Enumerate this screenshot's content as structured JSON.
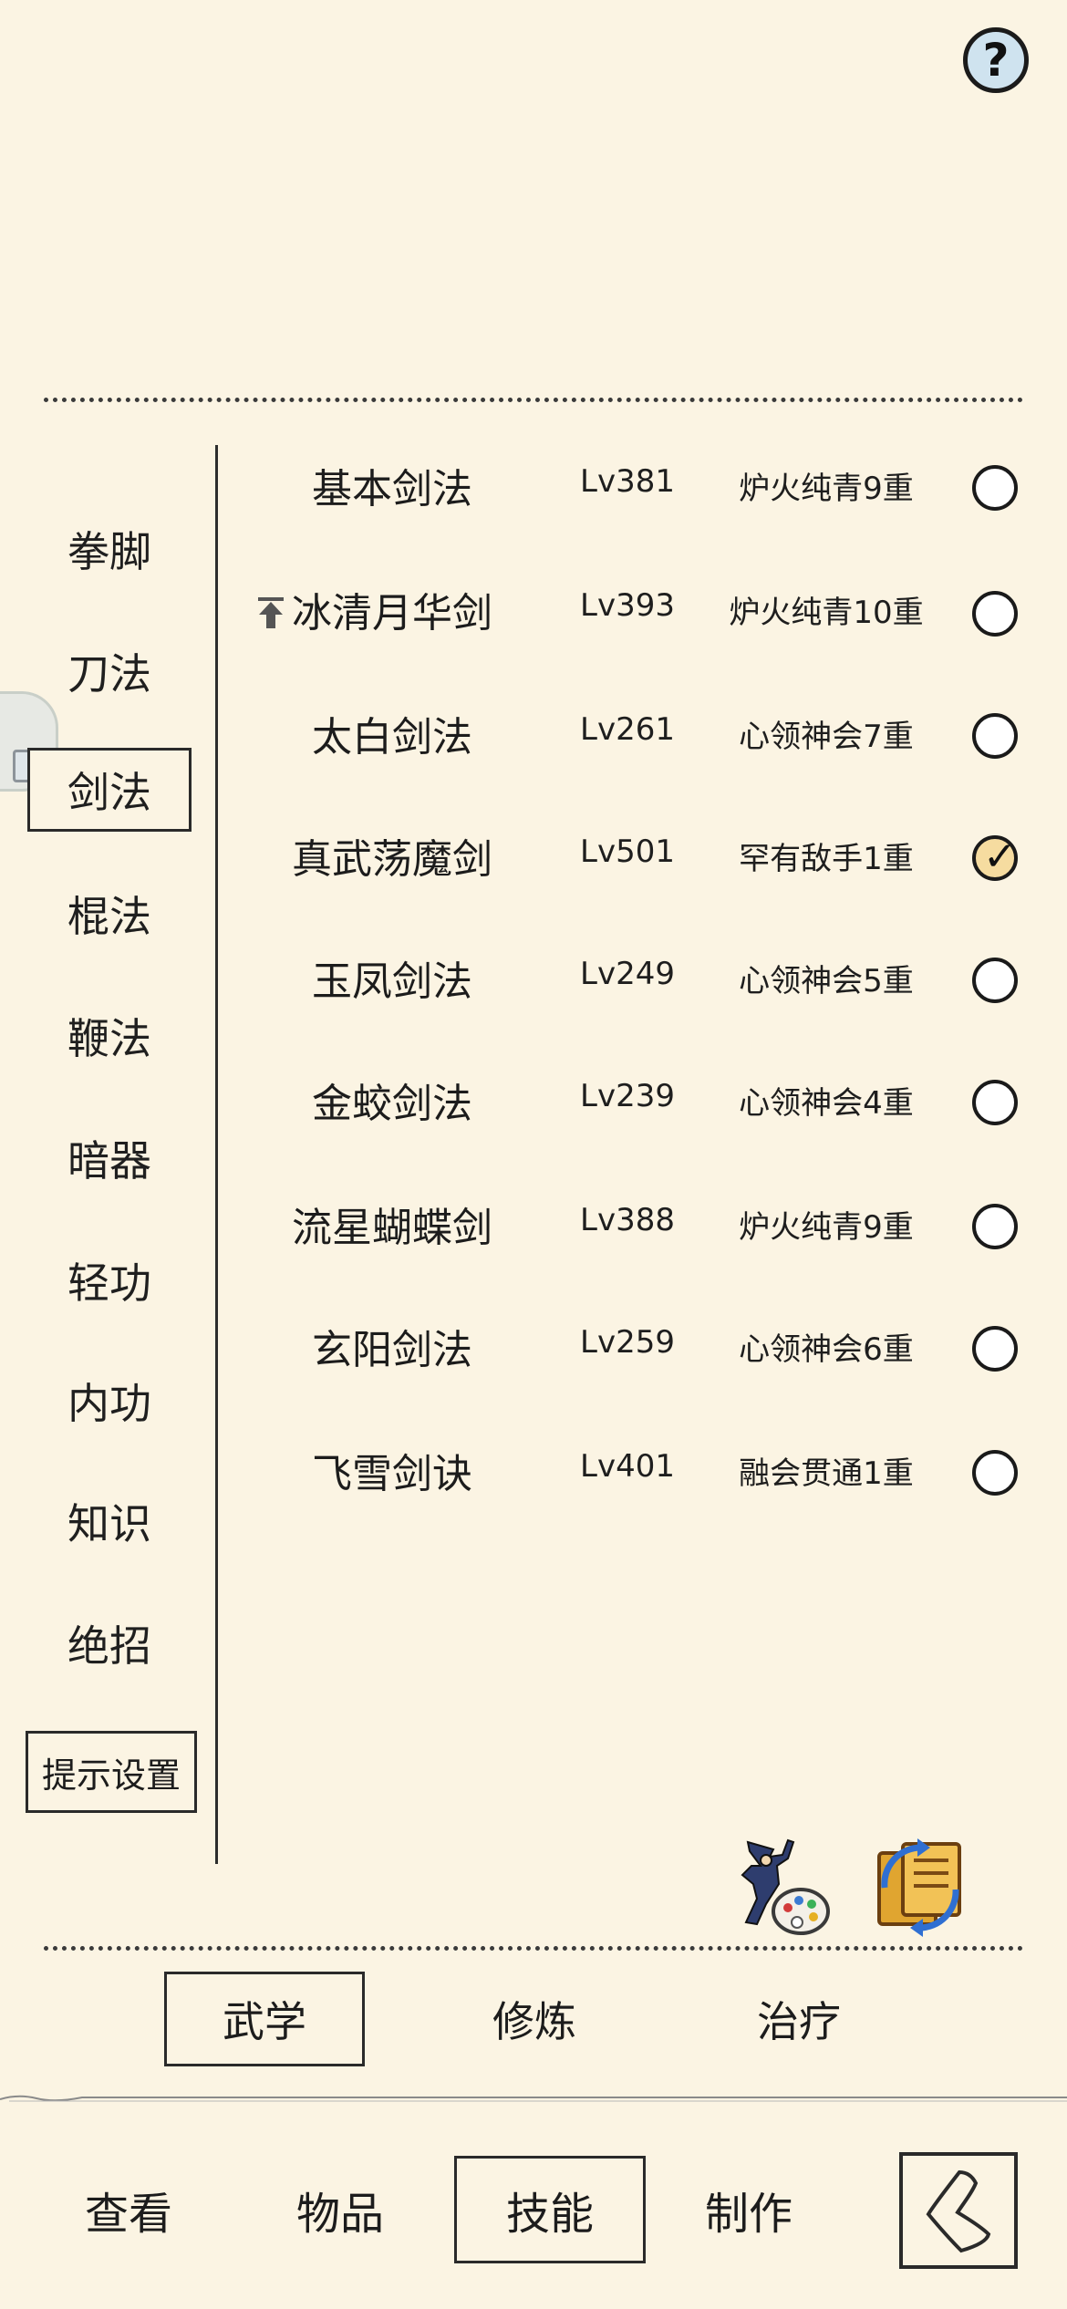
{
  "header": {
    "help_icon": "question-icon",
    "help_symbol": "?"
  },
  "categories": [
    {
      "label": "拳脚",
      "active": false
    },
    {
      "label": "刀法",
      "active": false
    },
    {
      "label": "剑法",
      "active": true
    },
    {
      "label": "棍法",
      "active": false
    },
    {
      "label": "鞭法",
      "active": false
    },
    {
      "label": "暗器",
      "active": false
    },
    {
      "label": "轻功",
      "active": false
    },
    {
      "label": "内功",
      "active": false
    },
    {
      "label": "知识",
      "active": false
    },
    {
      "label": "绝招",
      "active": false
    }
  ],
  "hint_settings_label": "提示设置",
  "skills": [
    {
      "name": "基本剑法",
      "level": "Lv381",
      "realm": "炉火纯青9重",
      "selected": false,
      "upgrade_icon": false
    },
    {
      "name": "冰清月华剑",
      "level": "Lv393",
      "realm": "炉火纯青10重",
      "selected": false,
      "upgrade_icon": true
    },
    {
      "name": "太白剑法",
      "level": "Lv261",
      "realm": "心领神会7重",
      "selected": false,
      "upgrade_icon": false
    },
    {
      "name": "真武荡魔剑",
      "level": "Lv501",
      "realm": "罕有敌手1重",
      "selected": true,
      "upgrade_icon": false
    },
    {
      "name": "玉凤剑法",
      "level": "Lv249",
      "realm": "心领神会5重",
      "selected": false,
      "upgrade_icon": false
    },
    {
      "name": "金蛟剑法",
      "level": "Lv239",
      "realm": "心领神会4重",
      "selected": false,
      "upgrade_icon": false
    },
    {
      "name": "流星蝴蝶剑",
      "level": "Lv388",
      "realm": "炉火纯青9重",
      "selected": false,
      "upgrade_icon": false
    },
    {
      "name": "玄阳剑法",
      "level": "Lv259",
      "realm": "心领神会6重",
      "selected": false,
      "upgrade_icon": false
    },
    {
      "name": "飞雪剑诀",
      "level": "Lv401",
      "realm": "融会贯通1重",
      "selected": false,
      "upgrade_icon": false
    }
  ],
  "tools": {
    "left_icon": "ninja-palette-icon",
    "right_icon": "scroll-swap-icon"
  },
  "sub_tabs": [
    {
      "label": "武学",
      "active": true
    },
    {
      "label": "修炼",
      "active": false
    },
    {
      "label": "治疗",
      "active": false
    }
  ],
  "main_tabs": [
    {
      "label": "查看",
      "active": false
    },
    {
      "label": "物品",
      "active": false
    },
    {
      "label": "技能",
      "active": true
    },
    {
      "label": "制作",
      "active": false
    }
  ],
  "back_icon": "back-arrow-icon",
  "colors": {
    "background": "#fbf4e3",
    "help_fill": "#cfe3ef",
    "checked_fill": "#f6dca0",
    "ink": "#1c1c1c"
  }
}
